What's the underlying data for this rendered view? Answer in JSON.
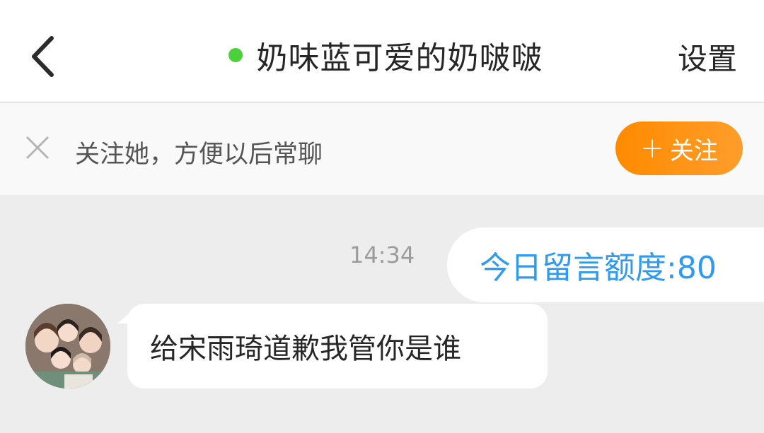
{
  "header": {
    "title": "奶味蓝可爱的奶啵啵",
    "settings_label": "设置",
    "online_color": "#4cd13a",
    "back_icon": "chevron-left-icon"
  },
  "follow_bar": {
    "prompt": "关注她，方便以后常聊",
    "button_label": "关注",
    "button_icon": "+",
    "close_icon": "close-icon"
  },
  "messages": [
    {
      "side": "right",
      "time": "14:34",
      "text": "今日留言额度:80"
    },
    {
      "side": "left",
      "text": "给宋雨琦道歉我管你是谁"
    }
  ]
}
